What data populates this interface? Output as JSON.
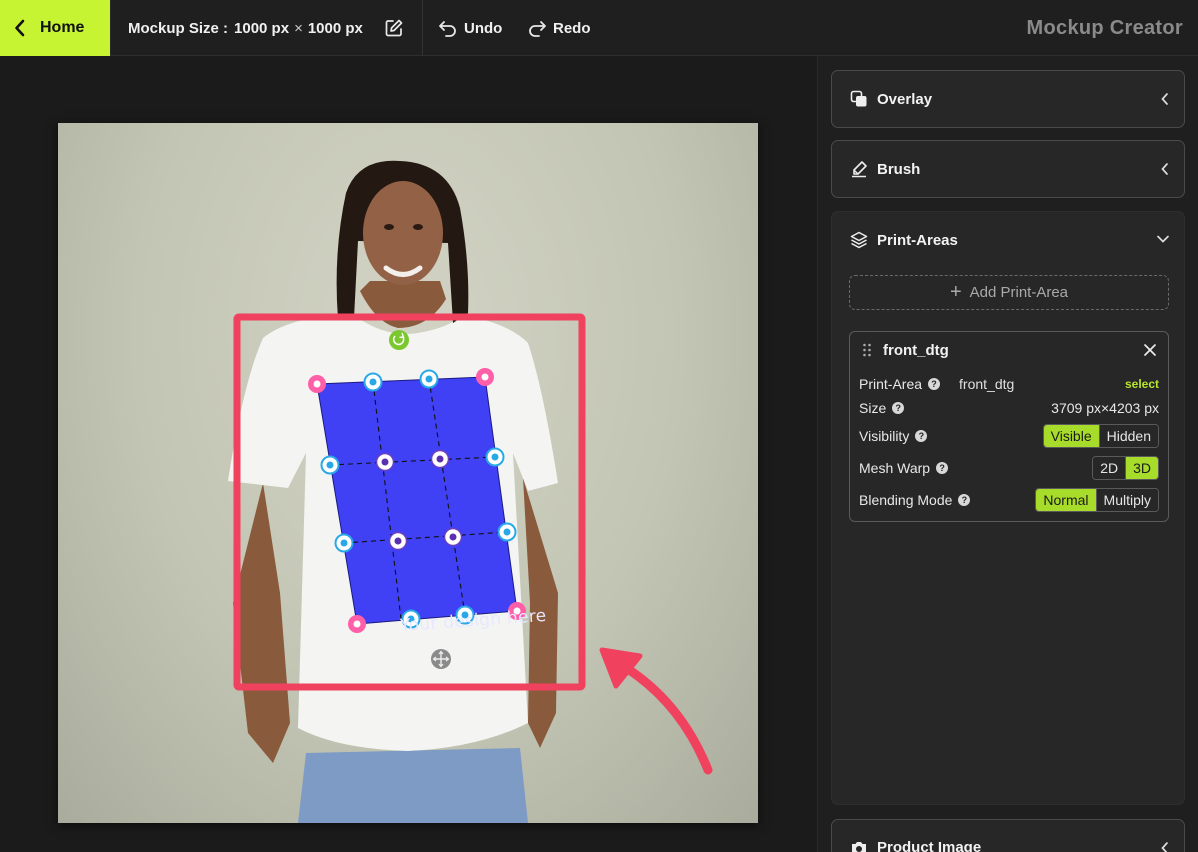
{
  "topbar": {
    "home_label": "Home",
    "mockup_size_label": "Mockup Size :",
    "width": "1000 px",
    "times": "×",
    "height": "1000 px",
    "undo_label": "Undo",
    "redo_label": "Redo",
    "app_title": "Mockup Creator",
    "accent_color": "#c6f432"
  },
  "canvas": {
    "design_placeholder": "Your design here",
    "print_area_fill_color": "#4040f5",
    "highlight_color": "#f0425e"
  },
  "panel": {
    "overlay_label": "Overlay",
    "brush_label": "Brush",
    "print_areas_label": "Print-Areas",
    "add_print_area_label": "Add Print-Area",
    "product_image_label": "Product Image",
    "card": {
      "title": "front_dtg",
      "print_area_label": "Print-Area",
      "print_area_value": "front_dtg",
      "select_label": "select",
      "size_label": "Size",
      "size_value": "3709 px×4203 px",
      "visibility_label": "Visibility",
      "visibility_options": [
        "Visible",
        "Hidden"
      ],
      "visibility_selected": "Visible",
      "mesh_warp_label": "Mesh Warp",
      "mesh_warp_options": [
        "2D",
        "3D"
      ],
      "mesh_warp_selected": "3D",
      "blending_mode_label": "Blending Mode",
      "blending_mode_options": [
        "Normal",
        "Multiply"
      ],
      "blending_mode_selected": "Normal"
    }
  }
}
